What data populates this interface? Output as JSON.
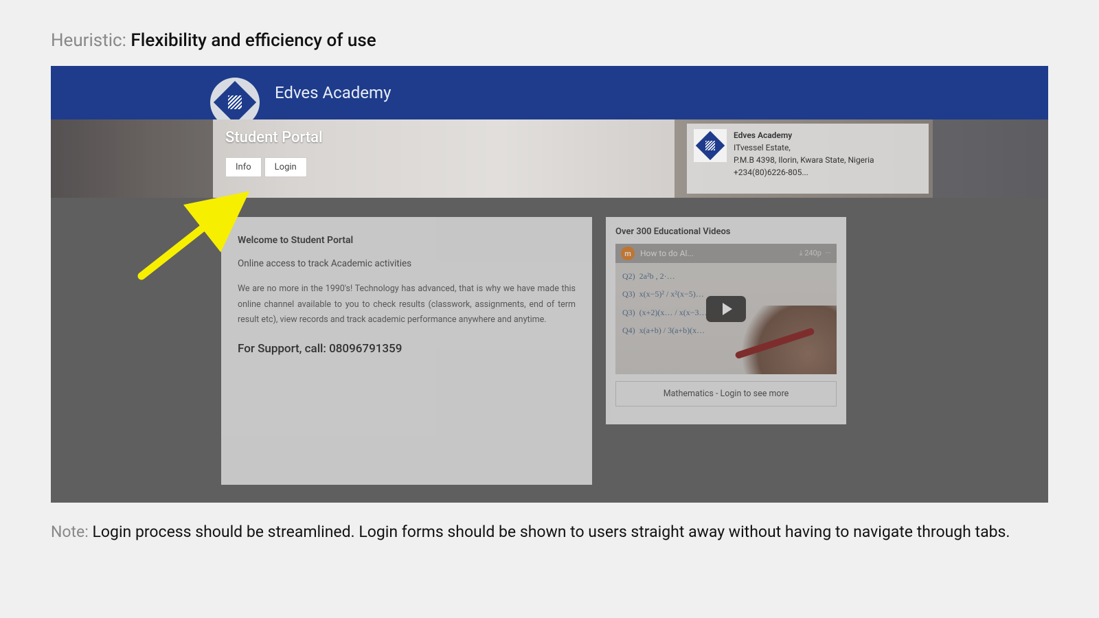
{
  "heuristic": {
    "label": "Heuristic: ",
    "value": "Flexibility and efficiency of use"
  },
  "site": {
    "title": "Edves Academy"
  },
  "portal": {
    "title": "Student Portal",
    "tabs": {
      "info": "Info",
      "login": "Login"
    }
  },
  "address": {
    "name": "Edves Academy",
    "line1": "ITvessel Estate,",
    "line2": "P.M.B 4398, Ilorin, Kwara State, Nigeria",
    "phone": "+234(80)6226-805..."
  },
  "welcome": {
    "title": "Welcome to Student Portal",
    "subtitle": "Online access to track Academic activities",
    "body": "We are no more in the 1990's! Technology has advanced, that is why we have made this online channel available to you to check results (classwork, assignments, end of term result etc), view records and track academic performance anywhere and anytime.",
    "support": "For Support, call: 08096791359"
  },
  "videos": {
    "heading": "Over 300 Educational Videos",
    "video_title": "How to do Al...",
    "quality": "240p",
    "badge": "m",
    "math": "Q2)  2a²b , 2·…\nQ3)  x(x−5)² / x²(x−5)…\nQ3)  (x+2)(x… / x(x−3…\nQ4)  x(a+b) / 3(a+b)(x…",
    "caption": "Mathematics - Login to see more"
  },
  "note": {
    "label": "Note: ",
    "text": "Login process should be streamlined. Login forms should be shown to users straight away without having to navigate through tabs."
  }
}
